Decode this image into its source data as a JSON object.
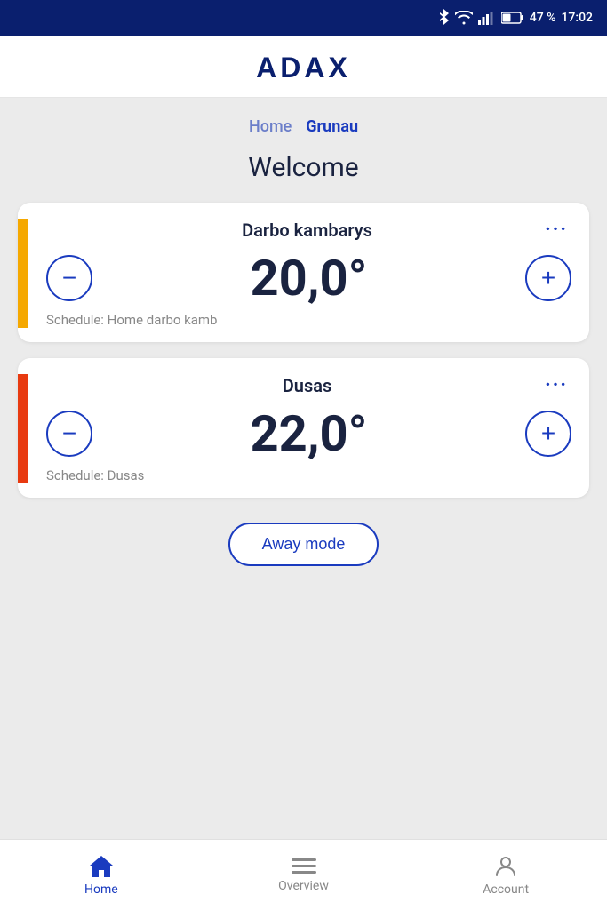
{
  "statusBar": {
    "battery": "47 %",
    "time": "17:02"
  },
  "header": {
    "logo": "ADAX"
  },
  "breadcrumb": {
    "items": [
      {
        "label": "Home",
        "active": false
      },
      {
        "label": "Grunau",
        "active": true
      }
    ]
  },
  "welcomeTitle": "Welcome",
  "rooms": [
    {
      "name": "Darbo kambarys",
      "temperature": "20,0°",
      "schedule": "Schedule: Home darbo kamb",
      "accentColor": "yellow"
    },
    {
      "name": "Dusas",
      "temperature": "22,0°",
      "schedule": "Schedule: Dusas",
      "accentColor": "orange"
    }
  ],
  "awayModeButton": "Away mode",
  "bottomNav": {
    "items": [
      {
        "label": "Home",
        "active": true,
        "icon": "home"
      },
      {
        "label": "Overview",
        "active": false,
        "icon": "overview"
      },
      {
        "label": "Account",
        "active": false,
        "icon": "account"
      }
    ]
  }
}
